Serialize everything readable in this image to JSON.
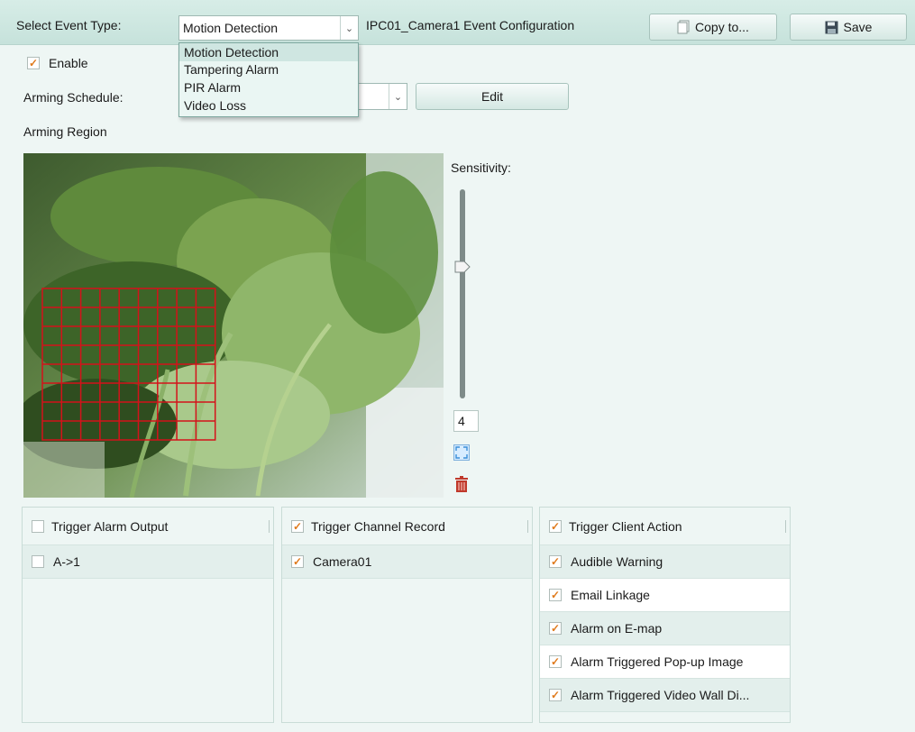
{
  "header": {
    "event_type_label": "Select Event Type:",
    "event_type_value": "Motion Detection",
    "config_title": "IPC01_Camera1 Event Configuration",
    "copy_label": "Copy to...",
    "save_label": "Save"
  },
  "event_type_options": [
    "Motion Detection",
    "Tampering Alarm",
    "PIR Alarm",
    "Video Loss"
  ],
  "enable_label": "Enable",
  "arming_schedule_label": "Arming Schedule:",
  "edit_label": "Edit",
  "arming_region_label": "Arming Region",
  "sensitivity": {
    "label": "Sensitivity:",
    "value": "4",
    "level_fraction": 0.63
  },
  "panels": {
    "alarm_output": {
      "header": "Trigger Alarm Output",
      "items": [
        "A->1"
      ]
    },
    "channel_record": {
      "header": "Trigger Channel Record",
      "items": [
        "Camera01"
      ]
    },
    "client_action": {
      "header": "Trigger Client Action",
      "items": [
        "Audible Warning",
        "Email Linkage",
        "Alarm on E-map",
        "Alarm Triggered Pop-up Image",
        "Alarm Triggered Video Wall Di..."
      ]
    }
  },
  "colors": {
    "accent_check": "#e07a1c",
    "grid": "#d4121a",
    "delete_icon": "#c0392b",
    "fullscreen_icon": "#3a8fd9"
  }
}
